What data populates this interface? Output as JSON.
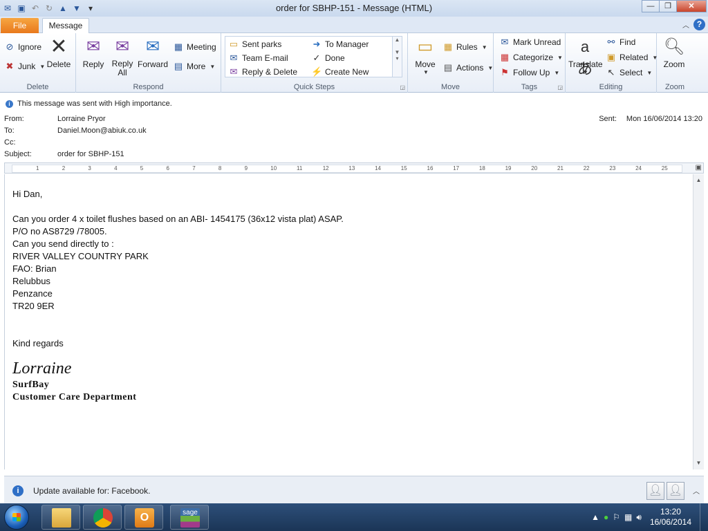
{
  "window": {
    "title": "order for SBHP-151  -  Message (HTML)",
    "minimize": "—",
    "maximize": "❐",
    "close": "✕"
  },
  "tabs": {
    "file": "File",
    "message": "Message"
  },
  "ribbon": {
    "delete_group": {
      "label": "Delete",
      "ignore": "Ignore",
      "junk": "Junk",
      "delete": "Delete"
    },
    "respond_group": {
      "label": "Respond",
      "reply": "Reply",
      "reply_all_1": "Reply",
      "reply_all_2": "All",
      "forward": "Forward",
      "meeting": "Meeting",
      "more": "More"
    },
    "quicksteps_group": {
      "label": "Quick Steps",
      "items": [
        "Sent parks",
        "To Manager",
        "Team E-mail",
        "Done",
        "Reply & Delete",
        "Create New"
      ]
    },
    "move_group": {
      "label": "Move",
      "move": "Move",
      "rules": "Rules",
      "actions": "Actions"
    },
    "tags_group": {
      "label": "Tags",
      "mark_unread": "Mark Unread",
      "categorize": "Categorize",
      "follow_up": "Follow Up"
    },
    "editing_group": {
      "label": "Editing",
      "translate": "Translate",
      "find": "Find",
      "related": "Related",
      "select": "Select"
    },
    "zoom_group": {
      "label": "Zoom",
      "zoom": "Zoom"
    }
  },
  "header": {
    "importance": "This message was sent with High importance.",
    "from_label": "From:",
    "from": "Lorraine Pryor",
    "to_label": "To:",
    "to": "Daniel.Moon@abiuk.co.uk",
    "cc_label": "Cc:",
    "cc": "",
    "subject_label": "Subject:",
    "subject": "order for SBHP-151",
    "sent_label": "Sent:",
    "sent": "Mon 16/06/2014 13:20"
  },
  "ruler": {
    "ticks": [
      "1",
      "2",
      "3",
      "4",
      "5",
      "6",
      "7",
      "8",
      "9",
      "10",
      "11",
      "12",
      "13",
      "14",
      "15",
      "16",
      "17",
      "18",
      "19",
      "20",
      "21",
      "22",
      "23",
      "24",
      "25"
    ]
  },
  "message": {
    "lines": [
      "Hi Dan,",
      "",
      "Can you order 4 x toilet flushes  based on an ABI- 1454175 (36x12 vista plat)  ASAP.",
      "P/O no AS8729 /78005.",
      "Can you send directly to :",
      "RIVER VALLEY COUNTRY PARK",
      "FAO: Brian",
      "Relubbus",
      "Penzance",
      "TR20 9ER",
      "",
      "",
      "Kind regards"
    ],
    "signature_name": "Lorraine",
    "company": "SurfBay",
    "department": "Customer Care Department"
  },
  "update_bar": {
    "text": "Update available for: Facebook."
  },
  "taskbar": {
    "apps": [
      "windows-explorer",
      "google-chrome",
      "microsoft-outlook",
      "sage"
    ],
    "time": "13:20",
    "date": "16/06/2014"
  },
  "colors": {
    "file_tab": "#e8791c",
    "ribbon_bg": "#e8eef7",
    "taskbar": "#1b3556"
  }
}
